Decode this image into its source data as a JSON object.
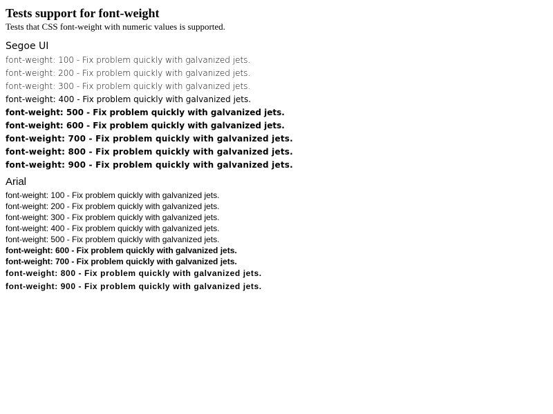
{
  "header": {
    "title": "Tests support for font-weight",
    "description": "Tests that CSS font-weight with numeric values is supported."
  },
  "sections": [
    {
      "heading": "Segoe UI",
      "lines": [
        "font-weight: 100 - Fix problem quickly with galvanized jets.",
        "font-weight: 200 - Fix problem quickly with galvanized jets.",
        "font-weight: 300 - Fix problem quickly with galvanized jets.",
        "font-weight: 400 - Fix problem quickly with galvanized jets.",
        "font-weight: 500 - Fix problem quickly with galvanized jets.",
        "font-weight: 600 - Fix problem quickly with galvanized jets.",
        "font-weight: 700 - Fix problem quickly with galvanized jets.",
        "font-weight: 800 - Fix problem quickly with galvanized jets.",
        "font-weight: 900 - Fix problem quickly with galvanized jets."
      ]
    },
    {
      "heading": "Arial",
      "lines": [
        "font-weight: 100 - Fix problem quickly with galvanized jets.",
        "font-weight: 200 - Fix problem quickly with galvanized jets.",
        "font-weight: 300 - Fix problem quickly with galvanized jets.",
        "font-weight: 400 - Fix problem quickly with galvanized jets.",
        "font-weight: 500 - Fix problem quickly with galvanized jets.",
        "font-weight: 600 - Fix problem quickly with galvanized jets.",
        "font-weight: 700 - Fix problem quickly with galvanized jets.",
        "font-weight: 800 - Fix problem quickly with galvanized jets.",
        "font-weight: 900 - Fix problem quickly with galvanized jets."
      ]
    }
  ]
}
